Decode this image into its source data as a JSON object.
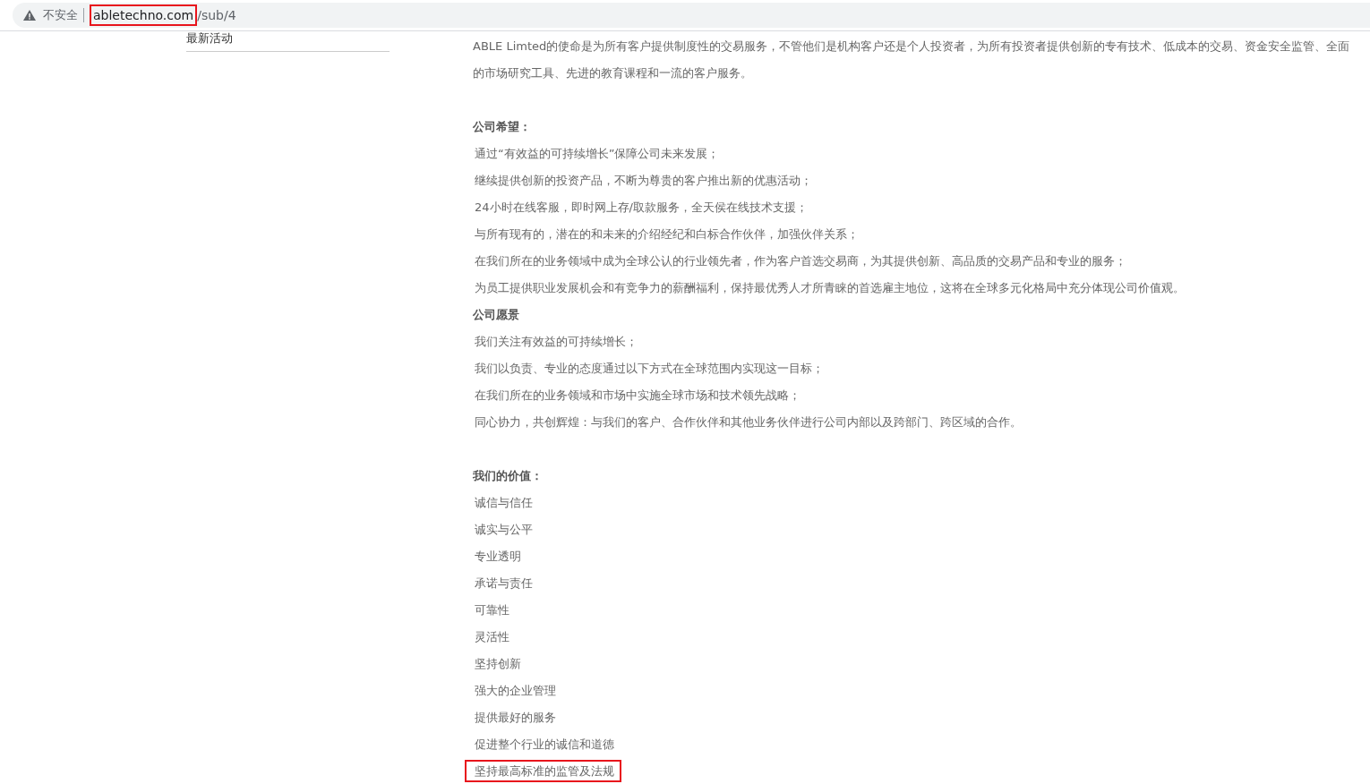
{
  "address_bar": {
    "security_label": "不安全",
    "host": "abletechno.com",
    "host_highlighted": true,
    "path": "/sub/4"
  },
  "sidebar": {
    "items": [
      "最新活动"
    ]
  },
  "intro": "ABLE Limted的使命是为所有客户提供制度性的交易服务，不管他们是机构客户还是个人投资者，为所有投资者提供创新的专有技术、低成本的交易、资金安全监管、全面的市场研究工具、先进的教育课程和一流的客户服务。",
  "blocks": [
    {
      "sections": [
        {
          "heading": "公司希望：",
          "lines": [
            {
              "text": "通过“有效益的可持续增长”保障公司未来发展；",
              "highlighted": false
            },
            {
              "text": "继续提供创新的投资产品，不断为尊贵的客户推出新的优惠活动；",
              "highlighted": false
            },
            {
              "text": "24小时在线客服，即时网上存/取款服务，全天侯在线技术支援；",
              "highlighted": false
            },
            {
              "text": "与所有现有的，潜在的和未来的介绍经纪和白标合作伙伴，加强伙伴关系；",
              "highlighted": false
            },
            {
              "text": "在我们所在的业务领域中成为全球公认的行业领先者，作为客户首选交易商，为其提供创新、高品质的交易产品和专业的服务；",
              "highlighted": false
            },
            {
              "text": "为员工提供职业发展机会和有竞争力的薪酬福利，保持最优秀人才所青睐的首选雇主地位，这将在全球多元化格局中充分体现公司价值观。",
              "highlighted": false
            }
          ]
        },
        {
          "heading": "公司愿景",
          "lines": [
            {
              "text": "我们关注有效益的可持续增长；",
              "highlighted": false
            },
            {
              "text": "我们以负责、专业的态度通过以下方式在全球范围内实现这一目标；",
              "highlighted": false
            },
            {
              "text": "在我们所在的业务领域和市场中实施全球市场和技术领先战略；",
              "highlighted": false
            },
            {
              "text": "同心协力，共创辉煌：与我们的客户、合作伙伴和其他业务伙伴进行公司内部以及跨部门、跨区域的合作。",
              "highlighted": false
            }
          ]
        }
      ]
    },
    {
      "sections": [
        {
          "heading": "我们的价值：",
          "lines": [
            {
              "text": "诚信与信任",
              "highlighted": false
            },
            {
              "text": "诚实与公平",
              "highlighted": false
            },
            {
              "text": "专业透明",
              "highlighted": false
            },
            {
              "text": "承诺与责任",
              "highlighted": false
            },
            {
              "text": "可靠性",
              "highlighted": false
            },
            {
              "text": "灵活性",
              "highlighted": false
            },
            {
              "text": "坚持创新",
              "highlighted": false
            },
            {
              "text": "强大的企业管理",
              "highlighted": false
            },
            {
              "text": "提供最好的服务",
              "highlighted": false
            },
            {
              "text": "促进整个行业的诚信和道德",
              "highlighted": false
            },
            {
              "text": "坚持最高标准的监管及法规",
              "highlighted": true
            }
          ]
        }
      ]
    }
  ]
}
